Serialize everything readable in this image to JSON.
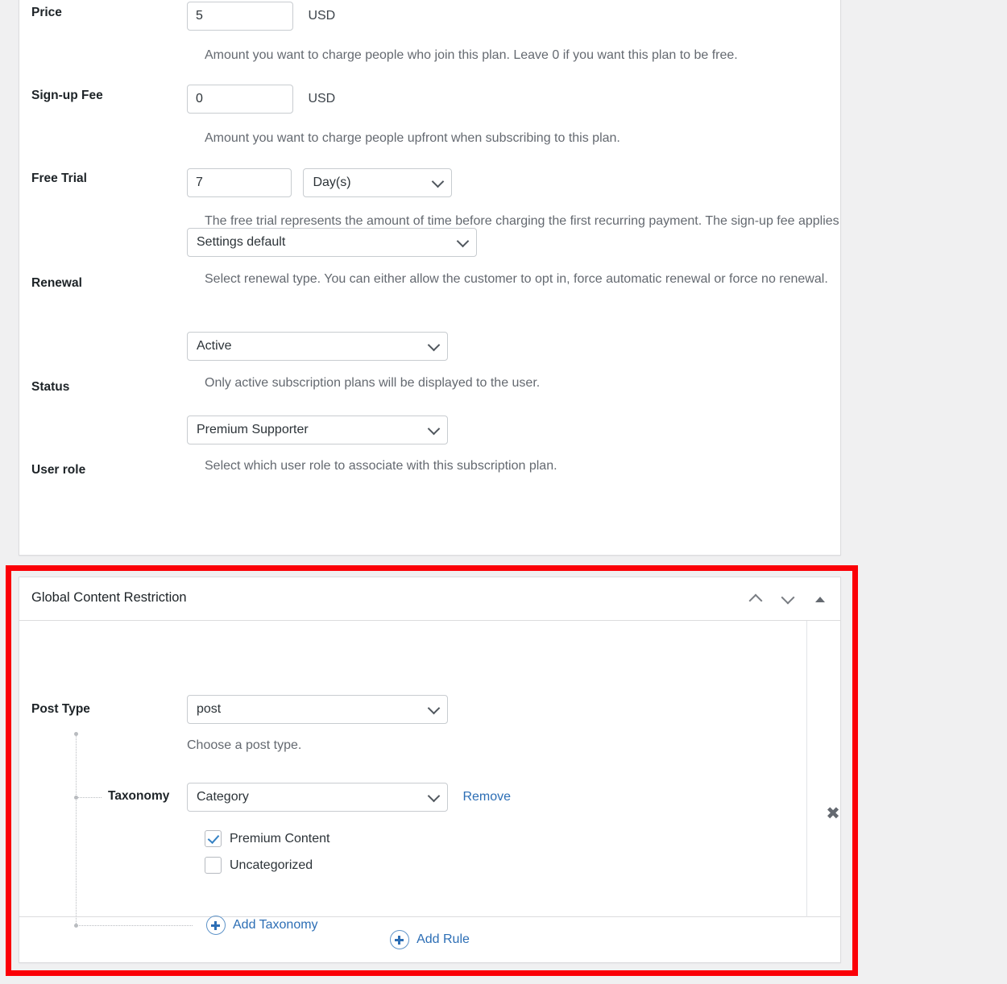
{
  "plan_settings": {
    "fields": [
      {
        "label": "Price",
        "value": "5",
        "unit": "USD",
        "help": "Amount you want to charge people who join this plan. Leave 0 if you want this plan to be free."
      },
      {
        "label": "Sign-up Fee",
        "value": "0",
        "unit": "USD",
        "help": "Amount you want to charge people upfront when subscribing to this plan."
      },
      {
        "label": "Free Trial",
        "value": "7",
        "period": "Day(s)",
        "help": "The free trial represents the amount of time before charging the first recurring payment. The sign-up fee applies regardless of the free trial."
      },
      {
        "label": "Renewal",
        "selected": "Settings default",
        "help": "Select renewal type. You can either allow the customer to opt in, force automatic renewal or force no renewal."
      },
      {
        "label": "Status",
        "selected": "Active",
        "help": "Only active subscription plans will be displayed to the user."
      },
      {
        "label": "User role",
        "selected": "Premium Supporter",
        "help": "Select which user role to associate with this subscription plan."
      }
    ]
  },
  "restriction_panel": {
    "title": "Global Content Restriction",
    "header_icons": {
      "move_up": "chevron-up-icon",
      "move_down": "chevron-down-icon",
      "toggle": "triangle-up-icon"
    },
    "rule": {
      "post_type": {
        "label": "Post Type",
        "selected": "post",
        "help": "Choose a post type."
      },
      "taxonomy": {
        "label": "Taxonomy",
        "selected": "Category",
        "remove_label": "Remove",
        "terms": [
          {
            "label": "Premium Content",
            "checked": true
          },
          {
            "label": "Uncategorized",
            "checked": false
          }
        ]
      },
      "add_taxonomy_label": "Add Taxonomy",
      "remove_rule_icon": "close-icon"
    },
    "add_rule_label": "Add Rule"
  },
  "colors": {
    "highlight": "#fb0007",
    "link": "#2c6eb5",
    "checkbox_check": "#3582c4",
    "page_bg": "#f0f0f1"
  }
}
